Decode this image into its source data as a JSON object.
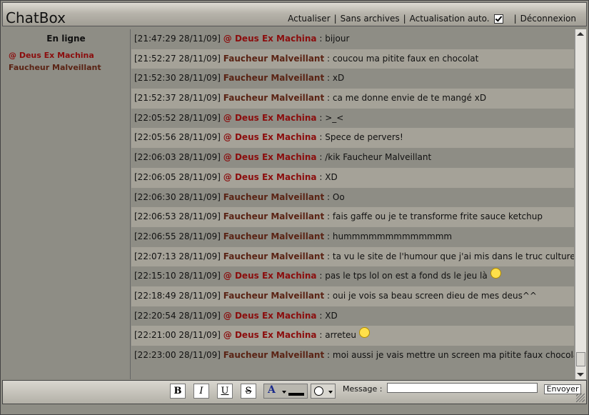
{
  "header": {
    "title": "ChatBox",
    "nav": {
      "refresh": "Actualiser",
      "no_archives": "Sans archives",
      "auto_refresh": "Actualisation auto.",
      "logout": "Déconnexion"
    }
  },
  "sidebar": {
    "title": "En ligne",
    "users": [
      "@ Deus Ex Machina",
      "Faucheur Malveillant"
    ]
  },
  "messages": [
    {
      "time": "[21:47:29 28/11/09]",
      "nick": "@ Deus Ex Machina",
      "sep": ":",
      "text": "bijour"
    },
    {
      "time": "[21:52:27 28/11/09]",
      "nick": "Faucheur Malveillant",
      "sep": ":",
      "text": "coucou ma pitite faux en chocolat"
    },
    {
      "time": "[21:52:30 28/11/09]",
      "nick": "Faucheur Malveillant",
      "sep": ":",
      "text": "xD"
    },
    {
      "time": "[21:52:37 28/11/09]",
      "nick": "Faucheur Malveillant",
      "sep": ":",
      "text": "ca me donne envie de te mangé xD"
    },
    {
      "time": "[22:05:52 28/11/09]",
      "nick": "@ Deus Ex Machina",
      "sep": ":",
      "text": ">_<"
    },
    {
      "time": "[22:05:56 28/11/09]",
      "nick": "@ Deus Ex Machina",
      "sep": ":",
      "text": "Spece de pervers!"
    },
    {
      "time": "[22:06:03 28/11/09]",
      "nick": "@ Deus Ex Machina",
      "sep": ":",
      "text": "/kik Faucheur Malveillant"
    },
    {
      "time": "[22:06:05 28/11/09]",
      "nick": "@ Deus Ex Machina",
      "sep": ":",
      "text": "XD"
    },
    {
      "time": "[22:06:30 28/11/09]",
      "nick": "Faucheur Malveillant",
      "sep": ":",
      "text": "Oo"
    },
    {
      "time": "[22:06:53 28/11/09]",
      "nick": "Faucheur Malveillant",
      "sep": ":",
      "text": "fais gaffe ou je te transforme frite sauce ketchup"
    },
    {
      "time": "[22:06:55 28/11/09]",
      "nick": "Faucheur Malveillant",
      "sep": ":",
      "text": "hummmmmmmmmmmmm"
    },
    {
      "time": "[22:07:13 28/11/09]",
      "nick": "Faucheur Malveillant",
      "sep": ":",
      "text": "ta vu le site de l'humour que j'ai mis dans le truc culture"
    },
    {
      "time": "[22:15:10 28/11/09]",
      "nick": "@ Deus Ex Machina",
      "sep": ":",
      "text": "pas le tps lol on est a fond ds le jeu là",
      "emoji": "smile-icon"
    },
    {
      "time": "[22:18:49 28/11/09]",
      "nick": "Faucheur Malveillant",
      "sep": ":",
      "text": "oui je vois sa beau screen dieu de mes deus^^"
    },
    {
      "time": "[22:20:54 28/11/09]",
      "nick": "@ Deus Ex Machina",
      "sep": ":",
      "text": "XD"
    },
    {
      "time": "[22:21:00 28/11/09]",
      "nick": "@ Deus Ex Machina",
      "sep": ":",
      "text": "arreteu",
      "emoji": "laugh-icon"
    },
    {
      "time": "[22:23:00 28/11/09]",
      "nick": "Faucheur Malveillant",
      "sep": ":",
      "text": "moi aussi je vais mettre un screen ma pitite faux chocolaté"
    }
  ],
  "toolbar": {
    "bold": "B",
    "italic": "I",
    "underline": "U",
    "strike": "S",
    "color_letter": "A",
    "message_label": "Message :",
    "message_value": "",
    "send": "Envoyer"
  },
  "colors": {
    "deus": "#8b0d0d",
    "faucheur": "#5a2314"
  }
}
